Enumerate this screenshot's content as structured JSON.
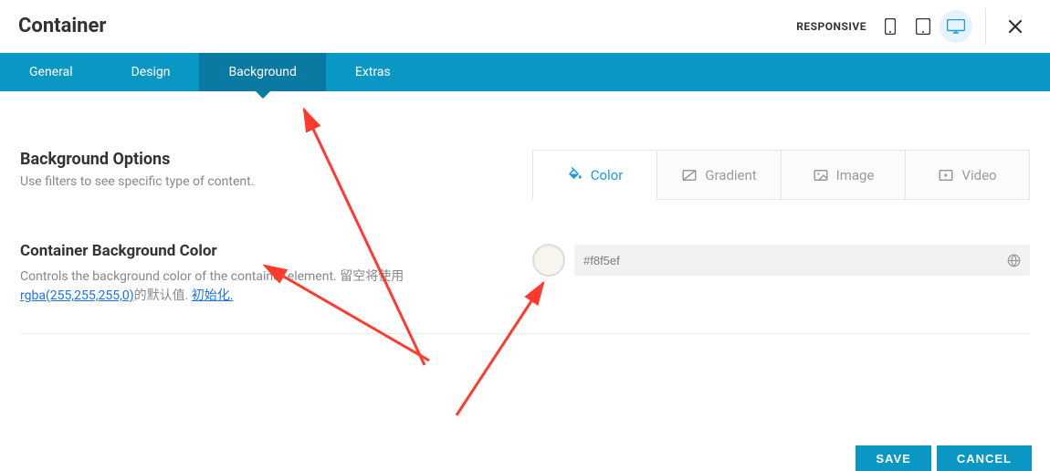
{
  "header": {
    "title": "Container",
    "responsive_label": "RESPONSIVE"
  },
  "tabs": [
    {
      "label": "General",
      "active": false
    },
    {
      "label": "Design",
      "active": false
    },
    {
      "label": "Background",
      "active": true
    },
    {
      "label": "Extras",
      "active": false
    }
  ],
  "section": {
    "title": "Background Options",
    "subtitle": "Use filters to see specific type of content."
  },
  "bg_tabs": {
    "color": "Color",
    "gradient": "Gradient",
    "image": "Image",
    "video": "Video"
  },
  "option": {
    "title": "Container Background Color",
    "desc_pre": "Controls the background color of the container element. 留空将使用",
    "desc_link1": "rgba(255,255,255,0)",
    "desc_mid": "的默认值. ",
    "desc_link2": "初始化.",
    "color_value": "#f8f5ef"
  },
  "footer": {
    "save": "SAVE",
    "cancel": "CANCEL"
  }
}
